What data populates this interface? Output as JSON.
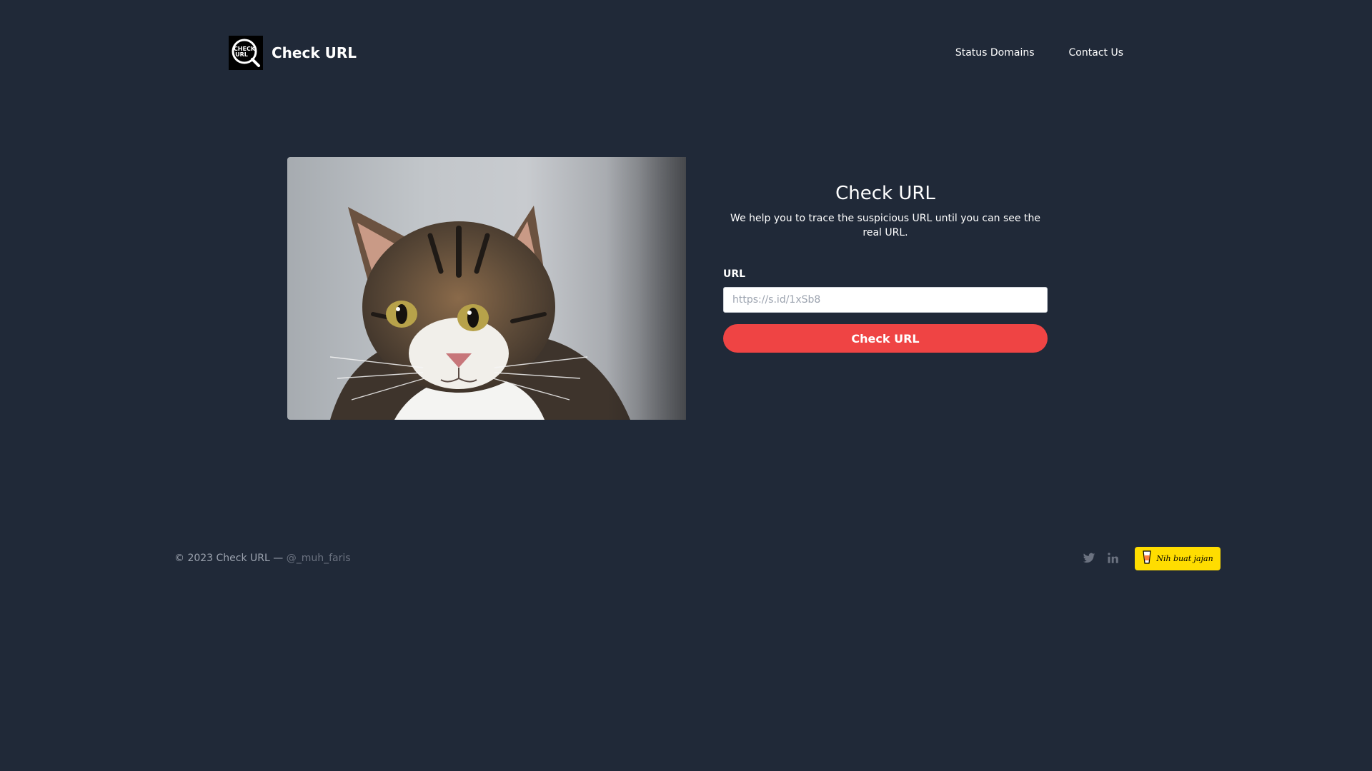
{
  "header": {
    "brand": "Check URL",
    "logo_text_top": "CHECK",
    "logo_text_bottom": "URL",
    "nav": [
      {
        "label": "Status Domains"
      },
      {
        "label": "Contact Us"
      }
    ]
  },
  "hero": {
    "image_icon": "cat-photo",
    "title": "Check URL",
    "description": "We help you to trace the suspicious URL until you can see the real URL.",
    "url_label": "URL",
    "url_placeholder": "https://s.id/1xSb8",
    "url_value": "",
    "submit_label": "Check URL"
  },
  "footer": {
    "copyright": "© 2023 Check URL —",
    "handle": "@_muh_faris",
    "social_icons": [
      "twitter-icon",
      "linkedin-icon"
    ],
    "donate_label": "Nih buat jajan"
  },
  "colors": {
    "background": "#202938",
    "button": "#ef4444",
    "donate": "#ffdd00"
  }
}
